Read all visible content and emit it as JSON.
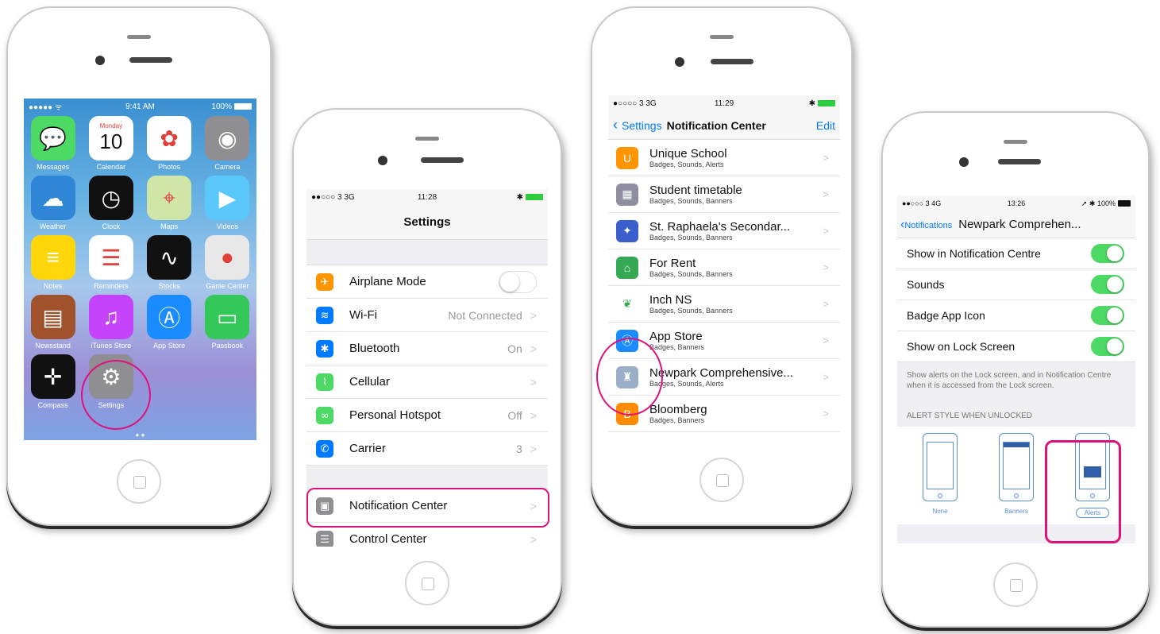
{
  "phone1": {
    "status": {
      "carrier": "●●●●● ᯤ",
      "time": "9:41 AM",
      "battery": "100%"
    },
    "apps": [
      {
        "label": "Messages",
        "icon": "messages-icon",
        "color": "#4cd964",
        "glyph": "💬"
      },
      {
        "label": "Calendar",
        "icon": "calendar-icon",
        "color": "#ffffff",
        "glyph": "10",
        "day": "Monday"
      },
      {
        "label": "Photos",
        "icon": "photos-icon",
        "color": "#ffffff",
        "glyph": "✿"
      },
      {
        "label": "Camera",
        "icon": "camera-icon",
        "color": "#8e8e93",
        "glyph": "◉"
      },
      {
        "label": "Weather",
        "icon": "weather-icon",
        "color": "#2f86d6",
        "glyph": "☁"
      },
      {
        "label": "Clock",
        "icon": "clock-icon",
        "color": "#111111",
        "glyph": "◷"
      },
      {
        "label": "Maps",
        "icon": "maps-icon",
        "color": "#cfe6a8",
        "glyph": "⌖"
      },
      {
        "label": "Videos",
        "icon": "videos-icon",
        "color": "#5ac8fa",
        "glyph": "▶"
      },
      {
        "label": "Notes",
        "icon": "notes-icon",
        "color": "#ffd60a",
        "glyph": "≡"
      },
      {
        "label": "Reminders",
        "icon": "reminders-icon",
        "color": "#ffffff",
        "glyph": "☰"
      },
      {
        "label": "Stocks",
        "icon": "stocks-icon",
        "color": "#111111",
        "glyph": "∿"
      },
      {
        "label": "Game Center",
        "icon": "game-center-icon",
        "color": "#e8e8e8",
        "glyph": "●"
      },
      {
        "label": "Newsstand",
        "icon": "newsstand-icon",
        "color": "#a0522d",
        "glyph": "▤"
      },
      {
        "label": "iTunes Store",
        "icon": "itunes-icon",
        "color": "#c643fc",
        "glyph": "♫"
      },
      {
        "label": "App Store",
        "icon": "app-store-icon",
        "color": "#1a8cff",
        "glyph": "Ⓐ"
      },
      {
        "label": "Passbook",
        "icon": "passbook-icon",
        "color": "#34c759",
        "glyph": "▭"
      },
      {
        "label": "Compass",
        "icon": "compass-icon",
        "color": "#111111",
        "glyph": "✛"
      },
      {
        "label": "Settings",
        "icon": "settings-icon",
        "color": "#8e8e93",
        "glyph": "⚙"
      }
    ],
    "dots": "● ●"
  },
  "phone2": {
    "status": {
      "carrier": "●●○○○ 3  3G",
      "time": "11:28",
      "battery": "✱"
    },
    "title": "Settings",
    "rows": [
      {
        "label": "Airplane Mode",
        "value": "",
        "icon": "airplane-icon",
        "color": "#ff9500",
        "glyph": "✈"
      },
      {
        "label": "Wi-Fi",
        "value": "Not Connected",
        "icon": "wifi-icon",
        "color": "#007aff",
        "glyph": "≋"
      },
      {
        "label": "Bluetooth",
        "value": "On",
        "icon": "bluetooth-icon",
        "color": "#007aff",
        "glyph": "✱"
      },
      {
        "label": "Cellular",
        "value": "",
        "icon": "cellular-icon",
        "color": "#4cd964",
        "glyph": "⌇"
      },
      {
        "label": "Personal Hotspot",
        "value": "Off",
        "icon": "hotspot-icon",
        "color": "#4cd964",
        "glyph": "∞"
      },
      {
        "label": "Carrier",
        "value": "3",
        "icon": "phone-icon",
        "color": "#007aff",
        "glyph": "✆"
      }
    ],
    "rows2": [
      {
        "label": "Notification Center",
        "icon": "notification-center-icon",
        "color": "#8e8e93",
        "glyph": "▣"
      },
      {
        "label": "Control Center",
        "icon": "control-center-icon",
        "color": "#8e8e93",
        "glyph": "☰"
      }
    ],
    "chevron": ">"
  },
  "phone3": {
    "status": {
      "carrier": "●○○○○ 3  3G",
      "time": "11:29",
      "battery": "✱"
    },
    "back": "Settings",
    "title": "Notification Center",
    "edit": "Edit",
    "apps": [
      {
        "name": "Unique School",
        "sub": "Badges, Sounds, Alerts",
        "icon": "unique-school-icon",
        "color": "#ff9500",
        "glyph": "U"
      },
      {
        "name": "Student timetable",
        "sub": "Badges, Sounds, Banners",
        "icon": "timetable-icon",
        "color": "#8e8ea0",
        "glyph": "▦"
      },
      {
        "name": "St. Raphaela's Secondar...",
        "sub": "Badges, Sounds, Banners",
        "icon": "st-raphaelas-icon",
        "color": "#3a5fcd",
        "glyph": "✦"
      },
      {
        "name": "For Rent",
        "sub": "Badges, Sounds, Banners",
        "icon": "for-rent-icon",
        "color": "#34a853",
        "glyph": "⌂"
      },
      {
        "name": "Inch NS",
        "sub": "Badges, Sounds, Banners",
        "icon": "inch-ns-icon",
        "color": "#ffffff",
        "glyph": "❦"
      },
      {
        "name": "App Store",
        "sub": "Badges, Banners",
        "icon": "app-store-icon",
        "color": "#1a8cff",
        "glyph": "Ⓐ"
      },
      {
        "name": "Newpark Comprehensive...",
        "sub": "Badges, Sounds, Alerts",
        "icon": "newpark-icon",
        "color": "#9bb0c8",
        "glyph": "♜"
      },
      {
        "name": "Bloomberg",
        "sub": "Badges, Banners",
        "icon": "bloomberg-icon",
        "color": "#ff8c00",
        "glyph": "B"
      }
    ],
    "chevron": ">"
  },
  "phone4": {
    "status": {
      "carrier": "●●○○○ 3  4G",
      "time": "13:26",
      "battery": "➚ ✱ 100%"
    },
    "back": "Notifications",
    "title": "Newpark Comprehen...",
    "toggles": [
      {
        "label": "Show in Notification Centre",
        "on": true
      },
      {
        "label": "Sounds",
        "on": true
      },
      {
        "label": "Badge App Icon",
        "on": true
      },
      {
        "label": "Show on Lock Screen",
        "on": true
      }
    ],
    "footer": "Show alerts on the Lock screen, and in Notification Centre when it is accessed from the Lock screen.",
    "section": "ALERT STYLE WHEN UNLOCKED",
    "styles": [
      {
        "label": "None"
      },
      {
        "label": "Banners"
      },
      {
        "label": "Alerts"
      }
    ]
  },
  "colors": {
    "highlight": "#e0107a",
    "toggle_on": "#4cd964",
    "ios_blue": "#007aff"
  }
}
